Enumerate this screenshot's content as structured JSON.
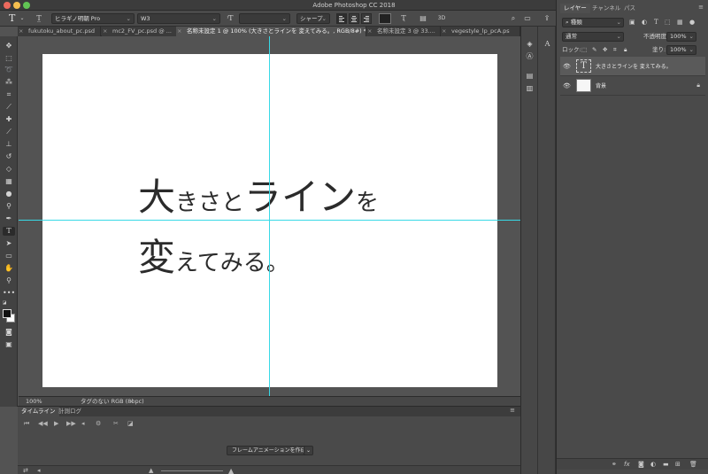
{
  "window": {
    "title": "Adobe Photoshop CC 2018"
  },
  "options": {
    "font_family": "ヒラギノ明朝 Pro",
    "font_style": "W3",
    "font_size": "",
    "antialias": "シャープ"
  },
  "tabs": [
    {
      "label": "fukutoku_about_pc.psd",
      "active": false
    },
    {
      "label": "mc2_FV_pc.psd @ ...",
      "active": false
    },
    {
      "label": "名称未設定 1 @ 100% (大きさとラインを 変えてみる。, RGB/8#) *",
      "active": true
    },
    {
      "label": "名称未設定 3 @ 33....",
      "active": false
    },
    {
      "label": "vegestyle_lp_pcA.ps",
      "active": false
    }
  ],
  "canvas_text": {
    "line1": [
      {
        "text": "大",
        "size": "big"
      },
      {
        "text": "きさと",
        "size": "small"
      },
      {
        "text": "ライン",
        "size": "big"
      },
      {
        "text": "を",
        "size": "small"
      }
    ],
    "line2": [
      {
        "text": "変",
        "size": "big"
      },
      {
        "text": "えてみる。",
        "size": "small"
      }
    ]
  },
  "status": {
    "zoom": "100%",
    "profile": "タグのない RGB (8bpc)"
  },
  "timeline": {
    "tab_timeline": "タイムライン",
    "tab_measure": "計測ログ",
    "create_button": "フレームアニメーションを作成"
  },
  "layers_panel": {
    "tab_layers": "レイヤー",
    "tab_channels": "チャンネル",
    "tab_paths": "パス",
    "filter_kind": "種類",
    "blend_mode": "通常",
    "opacity_label": "不透明度:",
    "opacity_value": "100%",
    "lock_label": "ロック:",
    "fill_label": "塗り:",
    "fill_value": "100%",
    "layers": [
      {
        "name": "大きさとラインを 変えてみる。",
        "type": "text",
        "selected": true
      },
      {
        "name": "背景",
        "type": "background",
        "selected": false
      }
    ]
  },
  "colors": {
    "guide": "#37d9e6",
    "canvas": "#ffffff",
    "workspace": "#535353"
  }
}
